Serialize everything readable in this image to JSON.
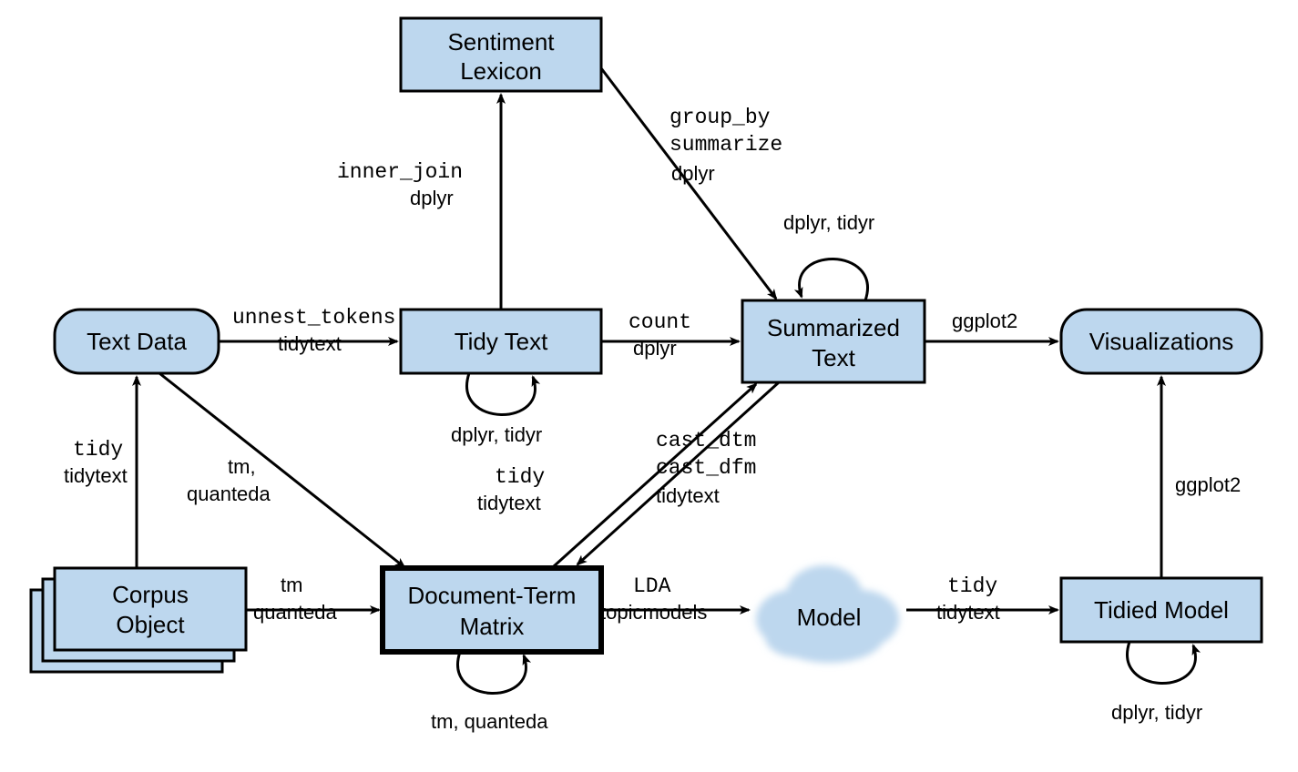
{
  "nodes": {
    "text_data": "Text Data",
    "tidy_text": "Tidy Text",
    "sentiment_lexicon_l1": "Sentiment",
    "sentiment_lexicon_l2": "Lexicon",
    "summarized_text_l1": "Summarized",
    "summarized_text_l2": "Text",
    "visualizations": "Visualizations",
    "corpus_object_l1": "Corpus",
    "corpus_object_l2": "Object",
    "dtm_l1": "Document-Term",
    "dtm_l2": "Matrix",
    "model": "Model",
    "tidied_model": "Tidied Model"
  },
  "edges": {
    "unnest_tokens": {
      "fn": "unnest_tokens",
      "pkg": "tidytext"
    },
    "inner_join": {
      "fn": "inner_join",
      "pkg": "dplyr"
    },
    "group_by": {
      "fn1": "group_by",
      "fn2": "summarize",
      "pkg": "dplyr"
    },
    "count": {
      "fn": "count",
      "pkg": "dplyr"
    },
    "ggplot2_top": {
      "pkg": "ggplot2"
    },
    "tidy_corpus": {
      "fn": "tidy",
      "pkg": "tidytext"
    },
    "tm_quanteda_diag": {
      "l1": "tm,",
      "l2": "quanteda"
    },
    "tm_quanteda_horiz": {
      "l1": "tm",
      "l2": "quanteda"
    },
    "tidy_dtm": {
      "fn": "tidy",
      "pkg": "tidytext"
    },
    "cast_dtm": {
      "fn1": "cast_dtm",
      "fn2": "cast_dfm",
      "pkg": "tidytext"
    },
    "lda": {
      "fn": "LDA",
      "pkg": "topicmodels"
    },
    "tidy_model": {
      "fn": "tidy",
      "pkg": "tidytext"
    },
    "ggplot2_right": {
      "pkg": "ggplot2"
    },
    "self_tidy_text": "dplyr, tidyr",
    "self_summarized": "dplyr, tidyr",
    "self_dtm": "tm, quanteda",
    "self_tidied_model": "dplyr, tidyr"
  }
}
